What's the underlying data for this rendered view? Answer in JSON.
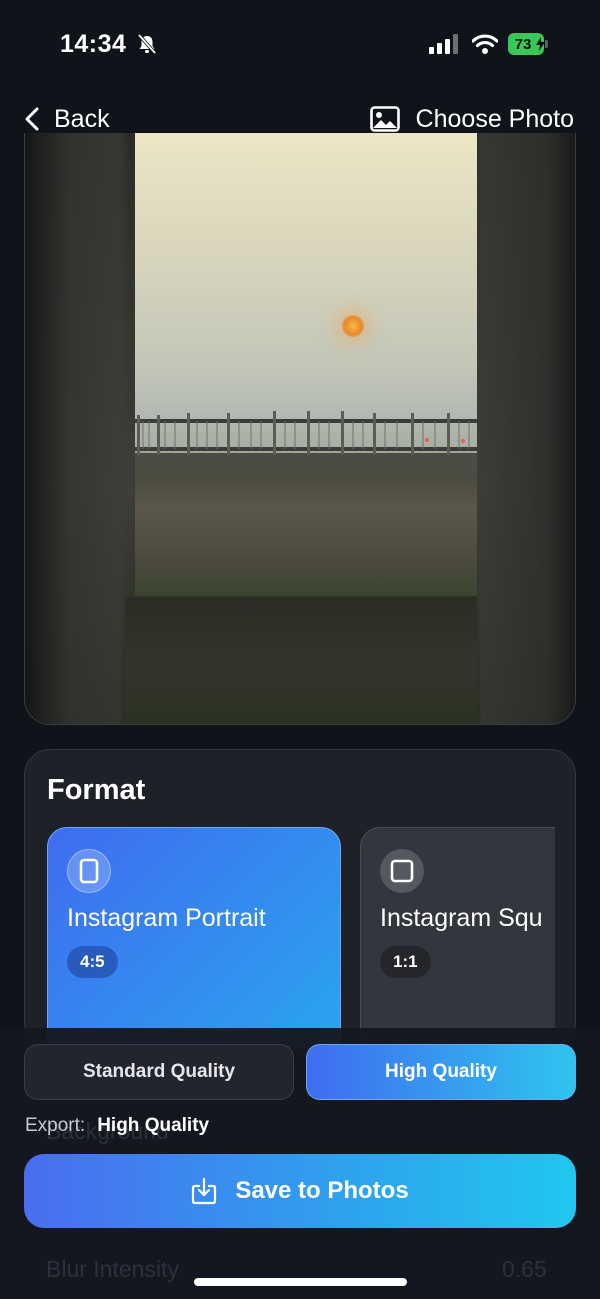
{
  "status_bar": {
    "time": "14:34",
    "battery_level": "73",
    "icons": [
      "bell-slash-icon",
      "signal-icon",
      "wifi-icon",
      "battery-icon"
    ]
  },
  "nav": {
    "back_label": "Back",
    "choose_label": "Choose Photo"
  },
  "format": {
    "title": "Format",
    "options": [
      {
        "name": "Instagram Portrait",
        "ratio": "4:5",
        "selected": true
      },
      {
        "name": "Instagram Squ",
        "ratio": "1:1",
        "selected": false
      }
    ]
  },
  "background_section": {
    "label": "Background",
    "blur_label": "Blur Intensity",
    "blur_value": "0.65"
  },
  "quality": {
    "options": [
      "Standard Quality",
      "High Quality"
    ],
    "selected": "High Quality"
  },
  "export": {
    "label": "Export:",
    "value": "High Quality"
  },
  "save": {
    "label": "Save to Photos"
  },
  "colors": {
    "accent_start": "#3f6cf0",
    "accent_end": "#2ac6ee",
    "background": "#11131b",
    "battery": "#38c857"
  }
}
